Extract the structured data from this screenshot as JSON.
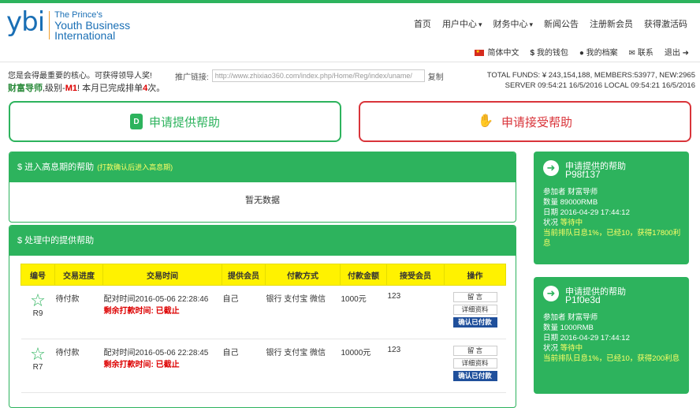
{
  "logo": {
    "mark": "ybi",
    "line1": "The Prince's",
    "line2": "Youth Business",
    "line3": "International"
  },
  "nav": [
    "首页",
    "用户中心",
    "财务中心",
    "新闻公告",
    "注册新会员",
    "获得激活码"
  ],
  "subnav": {
    "lang": "简体中文",
    "wallet": "我的钱包",
    "profile": "我的档案",
    "contact": "联系",
    "logout": "退出"
  },
  "user": {
    "welcome": "您是会得最重要的核心。可获得领导人奖!",
    "title": "财富导师",
    "level_prefix": ",级别-",
    "level": "M1",
    "rank_prefix": "! 本月已完成排单",
    "rank_count": "4",
    "rank_suffix": "次。"
  },
  "promo": {
    "label": "推广链接:",
    "value": "http://www.zhixiao360.com/index.php/Home/Reg/index/uname/",
    "copy": "复制"
  },
  "stats": {
    "line1": "TOTAL FUNDS: ¥ 243,154,188, MEMBERS:53977, NEW:2965",
    "line2": "SERVER  09:54:21 16/5/2016  LOCAL  09:54:21 16/5/2016"
  },
  "actions": {
    "provide": "申请提供帮助",
    "accept": "申请接受帮助"
  },
  "panel1": {
    "title": "$ 进入高息期的帮助",
    "sub": "(打款确认后进入高息期)",
    "empty": "暂无数据"
  },
  "panel2": {
    "title": "$ 处理中的提供帮助",
    "headers": [
      "编号",
      "交易进度",
      "交易时间",
      "提供会员",
      "付款方式",
      "付款金额",
      "接受会员",
      "操作"
    ],
    "rows": [
      {
        "id": "R9",
        "progress": "待付款",
        "time": "配对时间2016-05-06 22:28:46",
        "remaining_label": "剩余打款时间:",
        "remaining": "已截止",
        "provider": "自己",
        "method": "银行 支付宝 微信",
        "amount": "1000元",
        "receiver": "123"
      },
      {
        "id": "R7",
        "progress": "待付款",
        "time": "配对时间2016-05-06 22:28:45",
        "remaining_label": "剩余打款时间:",
        "remaining": "已截止",
        "provider": "自己",
        "method": "银行 支付宝 微信",
        "amount": "10000元",
        "receiver": "123"
      }
    ],
    "btn_msg": "留 言",
    "btn_detail": "详细资料",
    "btn_confirm": "确认已付款"
  },
  "side": [
    {
      "title": "申请提供的帮助",
      "code": "P98f137",
      "participant": "参加者  财富导师",
      "qty": "数量 89000RMB",
      "date": "日期 2016-04-29 17:44:12",
      "status_label": "状况",
      "status": "等待中",
      "note": "当前排队日息1%，已经10，获得17800利息"
    },
    {
      "title": "申请提供的帮助",
      "code": "P1f0e3d",
      "participant": "参加者  财富导师",
      "qty": "数量 1000RMB",
      "date": "日期 2016-04-29 17:44:12",
      "status_label": "状况",
      "status": "等待中",
      "note": "当前排队日息1%，已经10，获得200利息"
    }
  ]
}
